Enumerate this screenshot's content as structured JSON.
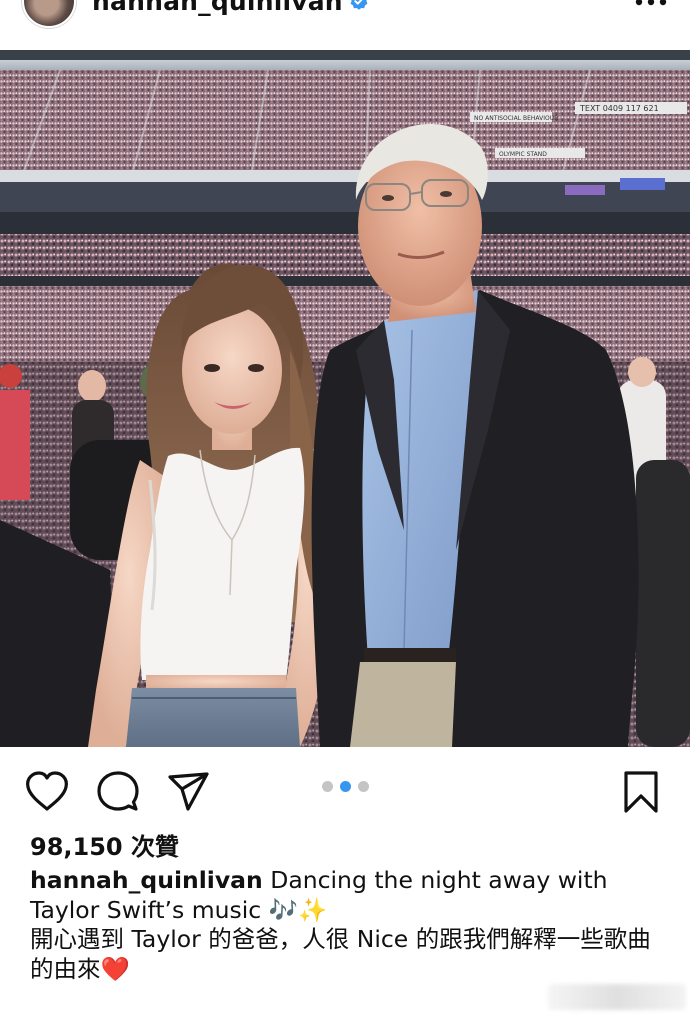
{
  "post": {
    "username": "hannah_quinlivan",
    "verified": true
  },
  "photo": {
    "signage": [
      "TEXT 0409 117 621",
      "NO ANTISOCIAL BEHAVIOUR",
      "OLYMPIC STAND"
    ]
  },
  "pagination": {
    "total": 3,
    "active_index": 1
  },
  "likes": {
    "label": "98,150 次贊"
  },
  "caption": {
    "username": "hannah_quinlivan",
    "text_line1": " Dancing the night away with Taylor Swift’s music 🎶✨",
    "text_line2": "開心遇到 Taylor 的爸爸，人很 Nice 的跟我們解釋一些歌曲的由來❤️"
  },
  "icons": {
    "like": "heart-icon",
    "comment": "comment-icon",
    "share": "send-icon",
    "save": "bookmark-icon",
    "more": "more-dots-icon",
    "verified": "verified-badge-icon"
  },
  "colors": {
    "verified_blue": "#3797f0",
    "active_dot": "#3797f0",
    "inactive_dot": "#c4c4c4",
    "text": "#111111"
  }
}
